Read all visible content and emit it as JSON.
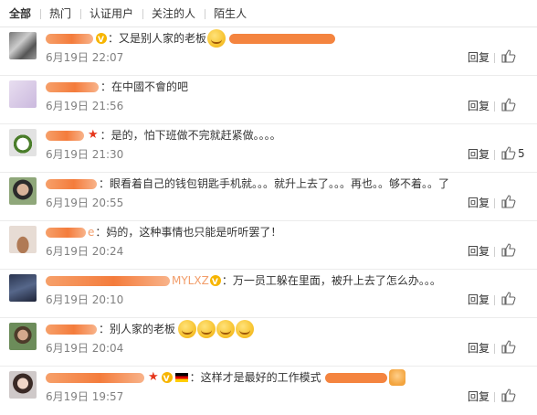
{
  "tabs": [
    "全部",
    "热门",
    "认证用户",
    "关注的人",
    "陌生人"
  ],
  "active_tab": 0,
  "reply_label": "回复",
  "comments": [
    {
      "text": "：又是别人家的老板",
      "time": "6月19日 22:07",
      "likes": ""
    },
    {
      "text": "：在中國不會的吧",
      "time": "6月19日 21:56",
      "likes": ""
    },
    {
      "text": "：是的，怕下班做不完就赶紧做。。。。",
      "time": "6月19日 21:30",
      "likes": "5"
    },
    {
      "text": "：眼看着自己的钱包钥匙手机就。。。就升上去了。。。再也。。够不着。。了",
      "time": "6月19日 20:55",
      "likes": ""
    },
    {
      "name_tail": "e",
      "text": "：妈的，这种事情也只能是听听罢了！",
      "time": "6月19日 20:24",
      "likes": ""
    },
    {
      "name_tail": "MYLXZ",
      "text": "：万一员工躲在里面，被升上去了怎么办。。。",
      "time": "6月19日 20:10",
      "likes": ""
    },
    {
      "text": "：别人家的老板",
      "time": "6月19日 20:04",
      "likes": ""
    },
    {
      "text": "：这样才是最好的工作模式",
      "time": "6月19日 19:57",
      "likes": ""
    }
  ],
  "icons": {
    "like": "thumbs-up-icon",
    "vip": "star-icon",
    "flag": "germany-flag-icon"
  }
}
